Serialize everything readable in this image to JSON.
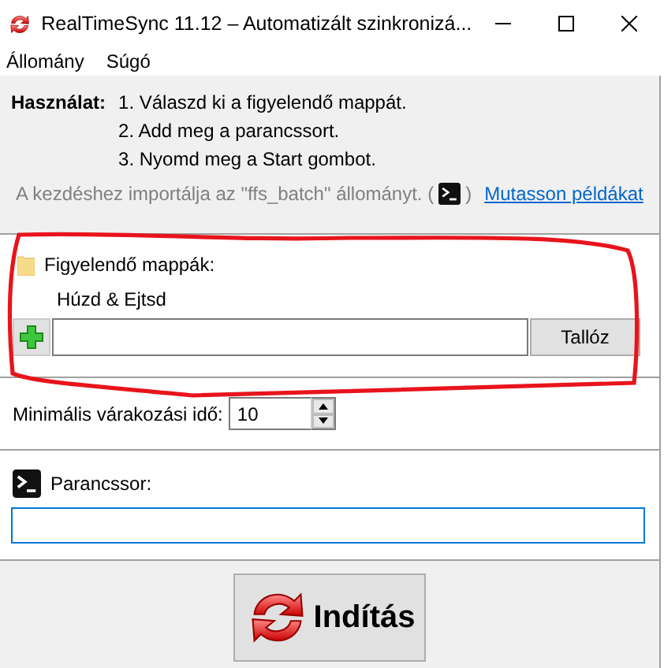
{
  "window": {
    "title": "RealTimeSync 11.12 – Automatizált szinkronizá..."
  },
  "menu": [
    "Állomány",
    "Súgó"
  ],
  "usage": {
    "label": "Használat:",
    "steps": [
      "1. Válaszd ki a figyelendő mappát.",
      "2. Add meg a parancssort.",
      "3. Nyomd meg a Start gombot."
    ],
    "import_hint": "A kezdéshez importálja az \"ffs_batch\" állományt. (",
    "import_hint_end": ")",
    "link": "Mutasson példákat"
  },
  "folders": {
    "label": "Figyelendő mappák:",
    "drop_hint": "Húzd & Ejtsd",
    "browse_button": "Tallóz"
  },
  "annotation": {
    "kind": "freehand-outline",
    "color": "#e8141c"
  },
  "min_wait": {
    "label": "Minimális várakozási idő:",
    "value": "10"
  },
  "command": {
    "label": "Parancssor:",
    "focused": true
  },
  "start_button": "Indítás"
}
